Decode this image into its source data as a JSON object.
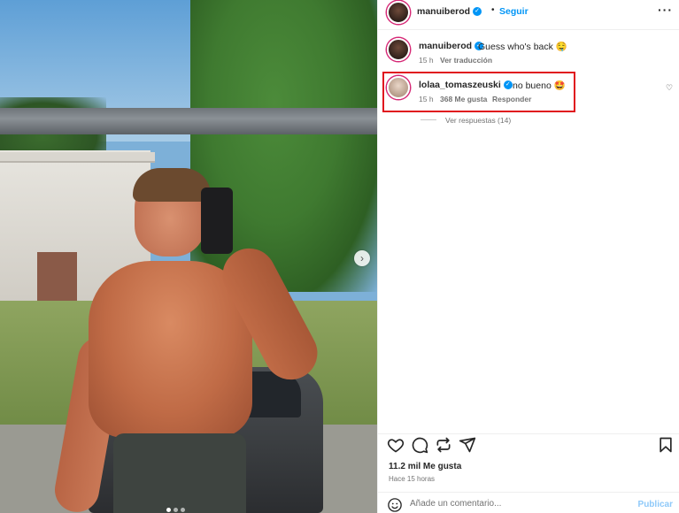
{
  "post": {
    "author": "manuiberod",
    "follow_label": "Seguir",
    "more_icon": "more-horizontal-icon",
    "caption": "Guess who's back 🤤",
    "caption_time": "15 h",
    "translate_label": "Ver traducción",
    "likes": "11.2 mil Me gusta",
    "posted": "Hace 15 horas"
  },
  "comment": {
    "author": "lolaa_tomaszeuski",
    "text": "no bueno 🤩",
    "time": "15 h",
    "likes": "368 Me gusta",
    "reply_label": "Responder",
    "view_replies": "Ver respuestas (14)"
  },
  "composer": {
    "placeholder": "Añade un comentario...",
    "publish_label": "Publicar"
  },
  "icons": {
    "verified": "verified-badge-icon",
    "like": "heart-icon",
    "comment": "comment-icon",
    "share": "repost-icon",
    "send": "send-icon",
    "save": "bookmark-icon",
    "emoji": "emoji-icon",
    "carousel_next": "chevron-right-icon"
  },
  "colors": {
    "accent": "#0095f6",
    "highlight_border": "#e0141e",
    "publish_disabled": "#8ec9f9"
  }
}
